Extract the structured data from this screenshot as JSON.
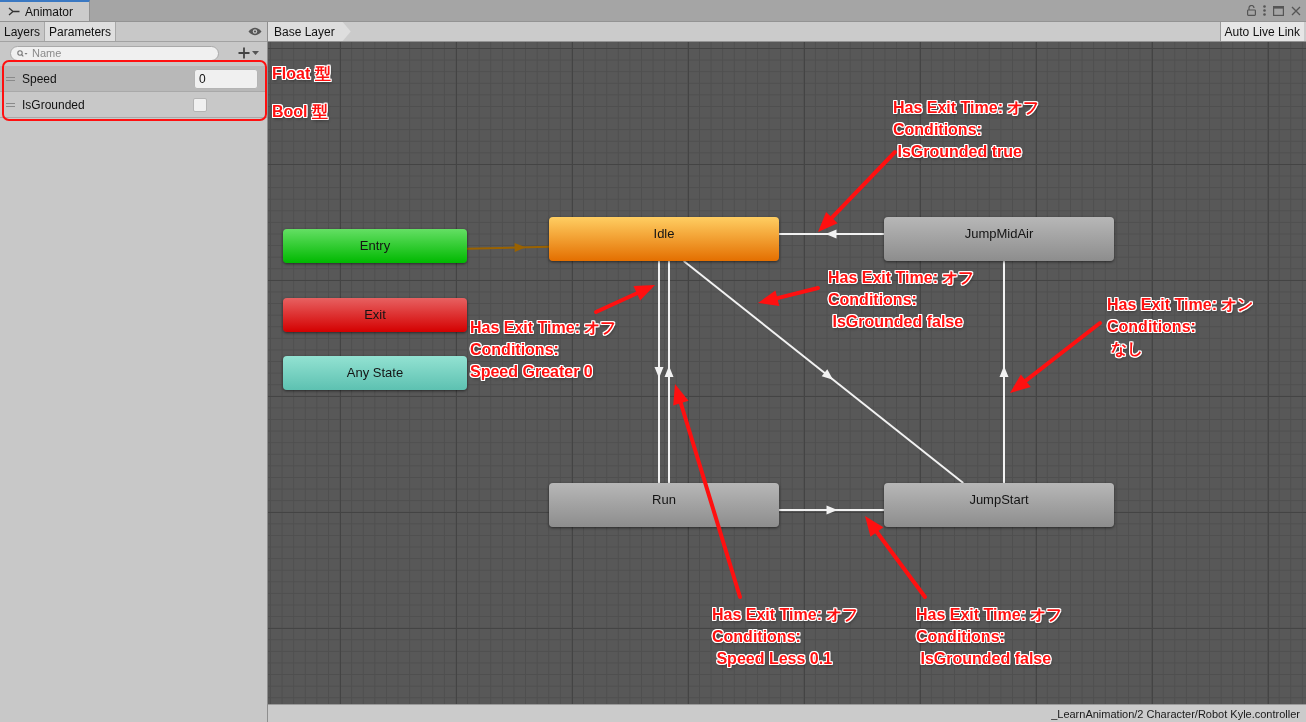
{
  "window": {
    "tab": "Animator"
  },
  "panel_tabs": [
    {
      "label": "Layers",
      "selected": false
    },
    {
      "label": "Parameters",
      "selected": true
    }
  ],
  "parameter_search": {
    "placeholder": "Name"
  },
  "parameters": [
    {
      "name": "Speed",
      "kind": "float",
      "value": "0",
      "selected": true
    },
    {
      "name": "IsGrounded",
      "kind": "bool",
      "checked": false,
      "selected": false
    }
  ],
  "breadcrumb": [
    "Base Layer"
  ],
  "auto_live_link": {
    "label": "Auto Live Link",
    "on": false
  },
  "states": [
    {
      "name": "Entry",
      "kind": "entry"
    },
    {
      "name": "Exit",
      "kind": "exit"
    },
    {
      "name": "Any State",
      "kind": "any"
    },
    {
      "name": "Idle",
      "kind": "default"
    },
    {
      "name": "JumpMidAir",
      "kind": "state"
    },
    {
      "name": "Run",
      "kind": "state"
    },
    {
      "name": "JumpStart",
      "kind": "state"
    }
  ],
  "annotations": {
    "type_labels": [
      "Float 型",
      "Bool 型"
    ],
    "callouts": [
      "Has Exit Time: オフ\nConditions:\n IsGrounded true",
      "Has Exit Time: オフ\nConditions:\n IsGrounded false",
      "Has Exit Time: オン\nConditions:\n なし",
      "Has Exit Time: オフ\nConditions:\nSpeed Greater 0",
      "Has Exit Time: オフ\nConditions:\n Speed Less 0.1",
      "Has Exit Time: オフ\nConditions:\n IsGrounded false"
    ]
  },
  "status_bar": {
    "path": "_LearnAnimation/2 Character/Robot Kyle.controller"
  }
}
